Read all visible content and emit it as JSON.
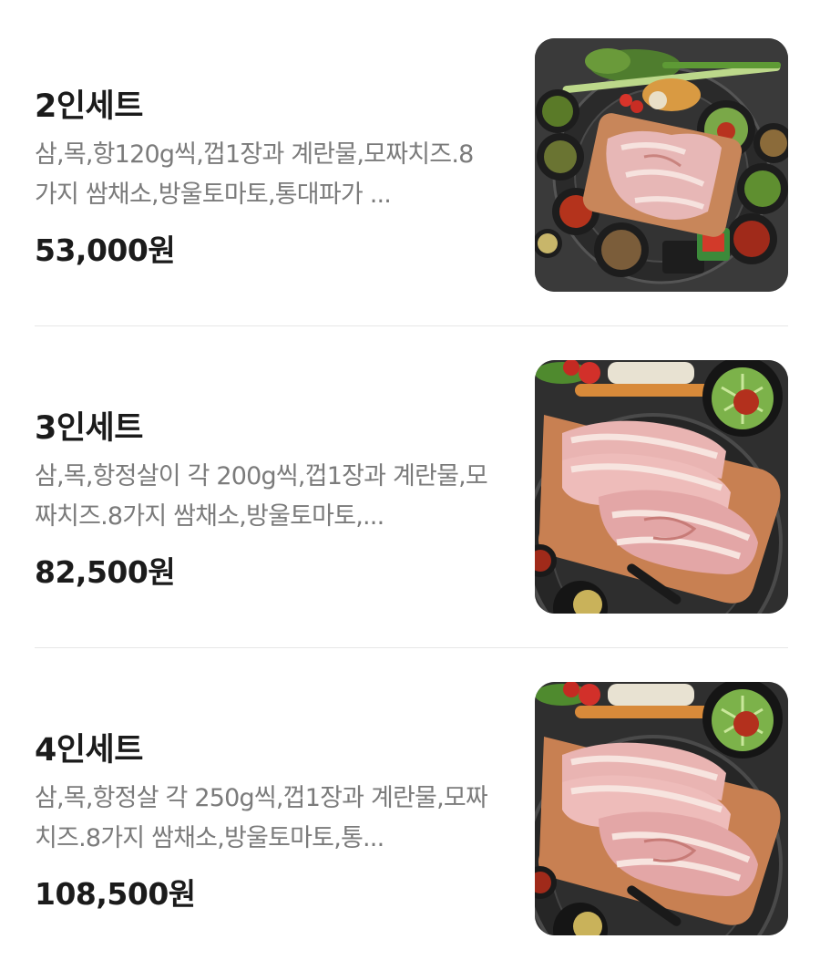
{
  "menu": {
    "items": [
      {
        "name": "2인세트",
        "description": "삼,목,항120g씩,껍1장과 계란물,모짜치즈.8가지 쌈채소,방울토마토,통대파가 ...",
        "price": "53,000원",
        "image_icon": "pork-bbq-set-photo"
      },
      {
        "name": "3인세트",
        "description": "삼,목,항정살이 각 200g씩,껍1장과 계란물,모짜치즈.8가지 쌈채소,방울토마토,...",
        "price": "82,500원",
        "image_icon": "pork-cuts-board-photo"
      },
      {
        "name": "4인세트",
        "description": "삼,목,항정살 각 250g씩,껍1장과 계란물,모짜치즈.8가지 쌈채소,방울토마토,통...",
        "price": "108,500원",
        "image_icon": "pork-cuts-board-photo"
      }
    ]
  },
  "colors": {
    "title": "#1b1b1b",
    "description": "#7b7b7b",
    "divider": "#e6e6e6",
    "background": "#ffffff"
  }
}
